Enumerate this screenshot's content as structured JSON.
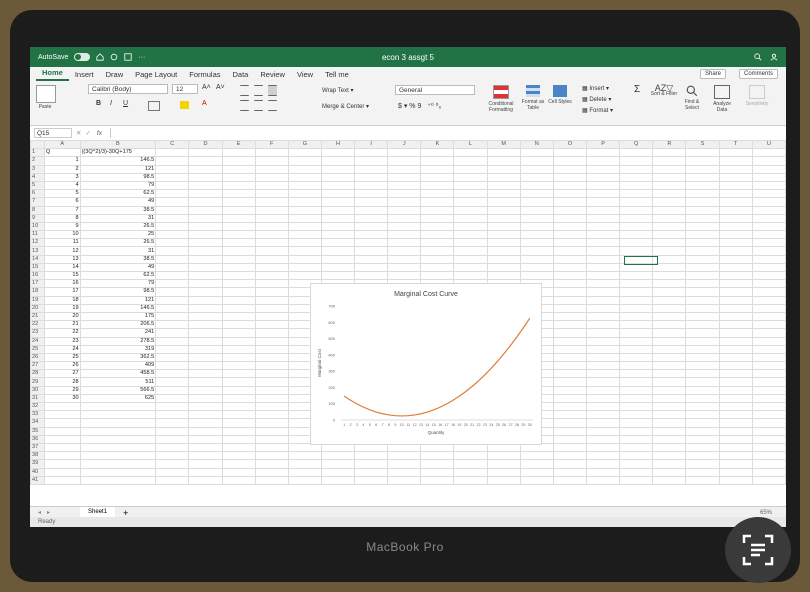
{
  "window": {
    "autosave_label": "AutoSave",
    "autosave_state": "OFF",
    "title": "econ 3 assgt 5",
    "laptop_brand": "MacBook Pro"
  },
  "tabs": [
    "Home",
    "Insert",
    "Draw",
    "Page Layout",
    "Formulas",
    "Data",
    "Review",
    "View",
    "Tell me"
  ],
  "active_tab": "Home",
  "header_buttons": {
    "share": "Share",
    "comments": "Comments"
  },
  "ribbon": {
    "paste": "Paste",
    "font_name": "Calibri (Body)",
    "font_size": "12",
    "wrap_text": "Wrap Text",
    "merge_center": "Merge & Center",
    "number_format": "General",
    "conditional_formatting": "Conditional Formatting",
    "format_as_table": "Format as Table",
    "cell_styles": "Cell Styles",
    "insert": "Insert",
    "delete": "Delete",
    "format": "Format",
    "sort_filter": "Sort & Filter",
    "find_select": "Find & Select",
    "analyze_data": "Analyze Data",
    "sensitivity": "Sensitivity"
  },
  "formula_bar": {
    "name_box": "Q15",
    "fx": "fx",
    "formula": ""
  },
  "sheet": {
    "columns": [
      "A",
      "B",
      "C",
      "D",
      "E",
      "F",
      "G",
      "H",
      "I",
      "J",
      "K",
      "L",
      "M",
      "N",
      "O",
      "P",
      "Q",
      "R",
      "S",
      "T",
      "U"
    ],
    "header_a": "Q",
    "header_b": "((3Q^2)/3)-30Q+175",
    "q_values": [
      1,
      2,
      3,
      4,
      5,
      6,
      7,
      8,
      9,
      10,
      11,
      12,
      13,
      14,
      15,
      16,
      17,
      18,
      19,
      20,
      21,
      22,
      23,
      24,
      25,
      26,
      27,
      28,
      29,
      30
    ],
    "cost_values": [
      "146.5",
      "121",
      "98.5",
      "79",
      "62.5",
      "49",
      "38.5",
      "31",
      "26.5",
      "25",
      "26.5",
      "31",
      "38.5",
      "49",
      "62.5",
      "79",
      "98.5",
      "121",
      "146.5",
      "175",
      "206.5",
      "241",
      "278.5",
      "319",
      "362.5",
      "409",
      "458.5",
      "511",
      "566.5",
      "625"
    ],
    "row_count": 41
  },
  "sheet_tab": "Sheet1",
  "status": "Ready",
  "zoom": "65%",
  "chart_data": {
    "type": "line",
    "title": "Marginal Cost Curve",
    "xlabel": "Quantity",
    "ylabel": "Marginal Cost",
    "x": [
      1,
      2,
      3,
      4,
      5,
      6,
      7,
      8,
      9,
      10,
      11,
      12,
      13,
      14,
      15,
      16,
      17,
      18,
      19,
      20,
      21,
      22,
      23,
      24,
      25,
      26,
      27,
      28,
      29,
      30
    ],
    "y": [
      146.5,
      121,
      98.5,
      79,
      62.5,
      49,
      38.5,
      31,
      26.5,
      25,
      26.5,
      31,
      38.5,
      49,
      62.5,
      79,
      98.5,
      121,
      146.5,
      175,
      206.5,
      241,
      278.5,
      319,
      362.5,
      409,
      458.5,
      511,
      566.5,
      625
    ],
    "yticks": [
      0,
      100,
      200,
      300,
      400,
      500,
      600,
      700
    ],
    "ylim": [
      0,
      700
    ],
    "line_color": "#e07b39",
    "grid": false
  }
}
